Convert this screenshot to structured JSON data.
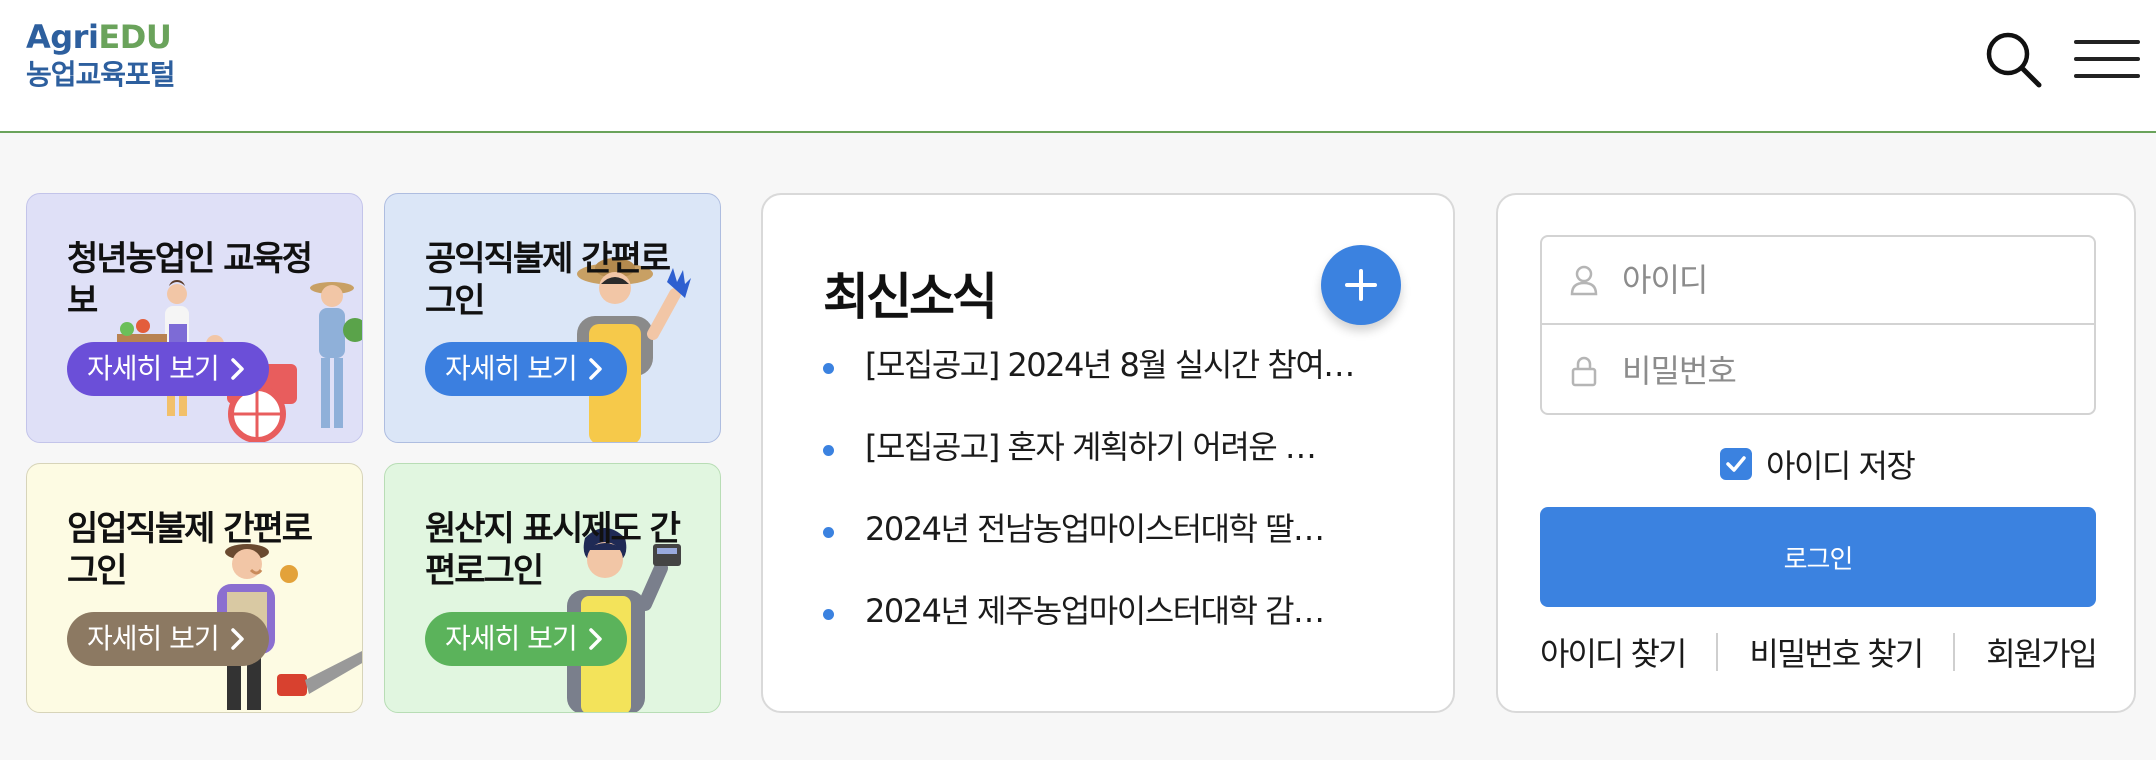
{
  "header": {
    "logo_agri": "Agri",
    "logo_edu": "EDU",
    "logo_sub": "농업교육포털",
    "search_icon": "search-icon",
    "menu_icon": "hamburger-menu-icon"
  },
  "cards": [
    {
      "title": "청년농업인 교육정보",
      "button": "자세히 보기",
      "accent": "#6b4fd8",
      "bg": "#dfe0f7"
    },
    {
      "title": "공익직불제 간편로그인",
      "button": "자세히 보기",
      "accent": "#3b7fe0",
      "bg": "#dbe6f7"
    },
    {
      "title": "임업직불제 간편로그인",
      "button": "자세히 보기",
      "accent": "#8c7962",
      "bg": "#fdfbe3"
    },
    {
      "title": "원산지 표시제도 간편로그인",
      "button": "자세히 보기",
      "accent": "#5bb35b",
      "bg": "#e1f6e0"
    }
  ],
  "news": {
    "title": "최신소식",
    "more_icon": "plus-icon",
    "items": [
      "[모집공고] 2024년 8월 실시간 참여…",
      "[모집공고] 혼자 계획하기 어려운 …",
      "2024년 전남농업마이스터대학 딸…",
      "2024년 제주농업마이스터대학 감…"
    ]
  },
  "login": {
    "id_placeholder": "아이디",
    "pw_placeholder": "비밀번호",
    "remember_label": "아이디 저장",
    "remember_checked": true,
    "login_button": "로그인",
    "links": [
      "아이디 찾기",
      "비밀번호 찾기",
      "회원가입"
    ]
  },
  "colors": {
    "primary": "#3b82e0",
    "header_line": "#6aa35b",
    "logo_blue": "#2d5f9e",
    "logo_green": "#6aa35b"
  }
}
